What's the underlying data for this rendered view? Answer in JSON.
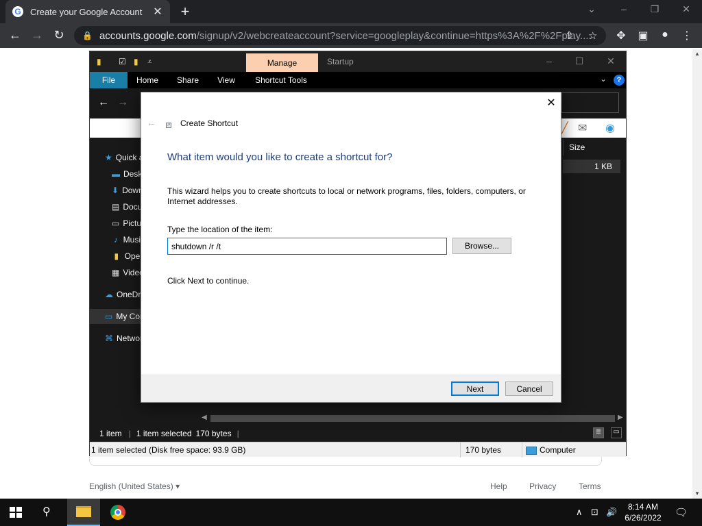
{
  "browser": {
    "tab_title": "Create your Google Account",
    "url_host": "accounts.google.com",
    "url_rest": "/signup/v2/webcreateaccount?service=googleplay&continue=https%3A%2F%2Fplay...."
  },
  "page_footer": {
    "language": "English (United States)",
    "help": "Help",
    "privacy": "Privacy",
    "terms": "Terms"
  },
  "explorer": {
    "manage_tab": "Manage",
    "title": "Startup",
    "ribbon_tabs": [
      "File",
      "Home",
      "Share",
      "View",
      "Shortcut Tools"
    ],
    "nav_items": [
      "Quick access",
      "Desktop",
      "Downloads",
      "Documents",
      "Pictures",
      "Music",
      "Open",
      "Videos",
      "OneDrive",
      "My Computer",
      "Network"
    ],
    "column_size": "Size",
    "row_size": "1 KB",
    "status": {
      "items": "1 item",
      "selected": "1 item selected",
      "bytes": "170 bytes"
    },
    "details": {
      "selection": "1 item selected (Disk free space: 93.9 GB)",
      "size": "170 bytes",
      "location": "Computer"
    }
  },
  "dialog": {
    "title": "Create Shortcut",
    "heading": "What item would you like to create a shortcut for?",
    "description": "This wizard helps you to create shortcuts to local or network programs, files, folders, computers, or Internet addresses.",
    "location_label": "Type the location of the item:",
    "location_value": "shutdown /r /t",
    "browse_label": "Browse...",
    "continue_hint": "Click Next to continue.",
    "next_label": "Next",
    "cancel_label": "Cancel"
  },
  "taskbar": {
    "time": "8:14 AM",
    "date": "6/26/2022"
  },
  "colors": {
    "file_tab": "#1a7fa6",
    "manage_tab": "#fbcfb0",
    "dialog_heading": "#1c3c78",
    "focus_border": "#0078d7"
  }
}
